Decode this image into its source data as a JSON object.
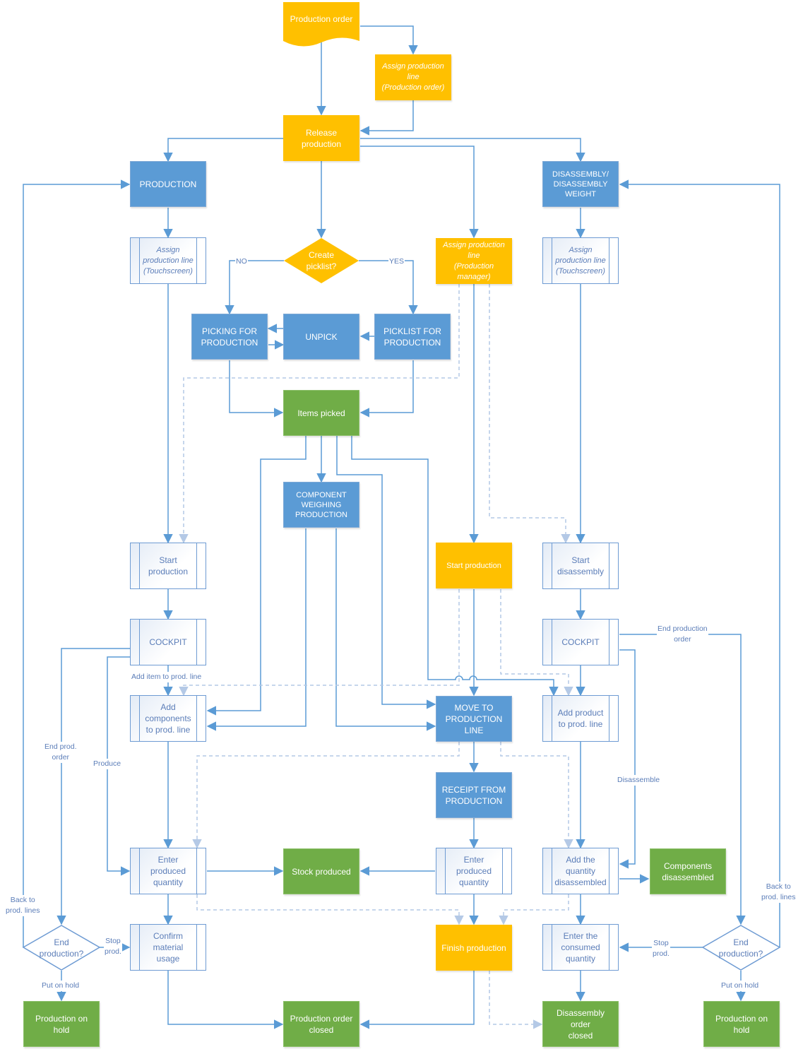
{
  "colors": {
    "start_process": "#FFC000",
    "module": "#5B9BD5",
    "outcome": "#70AD47",
    "subprocess_text": "#5B7DB8",
    "connector": "#5B9BD5",
    "optional_connector": "#B4C9E6"
  },
  "nodes": {
    "production_order": "Production order",
    "assign_line_prod_order": "Assign production\nline\n(Production order)",
    "release_production": "Release\nproduction",
    "production": "PRODUCTION",
    "disassembly": "DISASSEMBLY/\nDISASSEMBLY\nWEIGHT",
    "assign_line_touch_left": "Assign\nproduction line\n(Touchscreen)",
    "create_picklist": "Create\npicklist?",
    "assign_line_manager": "Assign production\nline\n(Production\nmanager)",
    "assign_line_touch_right": "Assign\nproduction line\n(Touchscreen)",
    "picking_for_production": "PICKING FOR\nPRODUCTION",
    "unpick": "UNPICK",
    "picklist_for_production": "PICKLIST FOR\nPRODUCTION",
    "items_picked": "Items picked",
    "component_weighing": "COMPONENT\nWEIGHING\nPRODUCTION",
    "start_production_left": "Start\nproduction",
    "start_production_mid": "Start production",
    "start_disassembly": "Start\ndisassembly",
    "cockpit_left": "COCKPIT",
    "cockpit_right": "COCKPIT",
    "add_components": "Add\ncomponents\nto prod. line",
    "move_to_production_line": "MOVE TO\nPRODUCTION\nLINE",
    "add_product": "Add product\nto prod. line",
    "receipt_from_production": "RECEIPT FROM\nPRODUCTION",
    "enter_produced_left": "Enter\nproduced\nquantity",
    "stock_produced": "Stock produced",
    "enter_produced_mid": "Enter\nproduced\nquantity",
    "add_qty_disassembled": "Add  the\nquantity\ndisassembled",
    "components_disassembled": "Components\ndisassembled",
    "end_production_left": "End\nproduction?",
    "confirm_material_usage": "Confirm\nmaterial\nusage",
    "finish_production": "Finish production",
    "enter_consumed_qty": "Enter the\nconsumed\nquantity",
    "end_production_right": "End\nproduction?",
    "production_on_hold_left": "Production on\nhold",
    "production_order_closed": "Production order\nclosed",
    "disassembly_order_closed": "Disassembly\norder\nclosed",
    "production_on_hold_right": "Production on\nhold"
  },
  "edge_labels": {
    "no": "NO",
    "yes": "YES",
    "add_item_to_prod_line": "Add item to prod. line",
    "end_prod_order_left": "End prod.\norder",
    "produce": "Produce",
    "end_production_order_right": "End production\norder",
    "disassemble": "Disassemble",
    "back_to_prod_lines_left": "Back to\nprod. lines",
    "back_to_prod_lines_right": "Back to\nprod. lines",
    "stop_prod_left": "Stop\nprod.",
    "stop_prod_right": "Stop\nprod.",
    "put_on_hold_left": "Put on hold",
    "put_on_hold_right": "Put on hold"
  }
}
